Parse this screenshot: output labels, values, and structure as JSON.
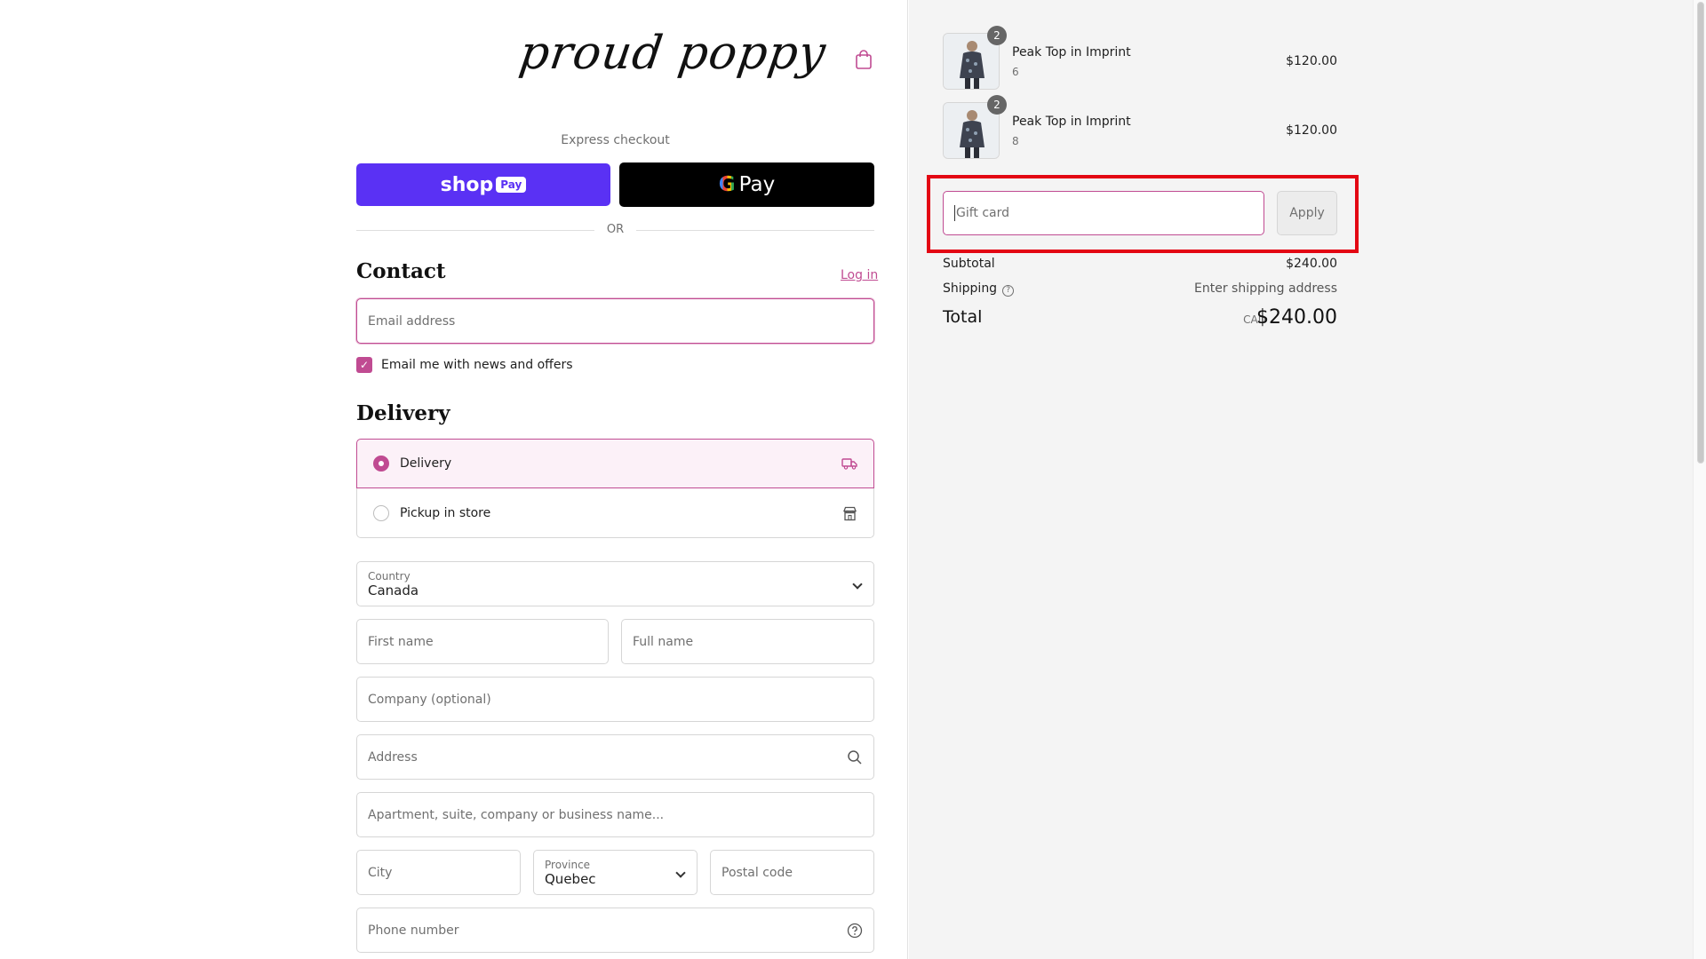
{
  "header": {
    "logo_text": "proud poppy"
  },
  "express": {
    "label": "Express checkout",
    "shop_pay": {
      "shop": "shop",
      "pay": "Pay"
    },
    "google_pay": {
      "g": "G",
      "pay": "Pay"
    },
    "or": "OR"
  },
  "contact": {
    "heading": "Contact",
    "login_link": "Log in",
    "email_placeholder": "Email address",
    "newsletter_label": "Email me with news and offers",
    "newsletter_checked": true
  },
  "delivery": {
    "heading": "Delivery",
    "options": [
      {
        "label": "Delivery",
        "selected": true,
        "icon": "truck-icon"
      },
      {
        "label": "Pickup in store",
        "selected": false,
        "icon": "store-icon"
      }
    ],
    "country": {
      "label": "Country",
      "value": "Canada"
    },
    "first_name_placeholder": "First name",
    "last_name_placeholder": "Full name",
    "company_placeholder": "Company (optional)",
    "address_placeholder": "Address",
    "apartment_placeholder": "Apartment, suite, company or business name...",
    "city_placeholder": "City",
    "province": {
      "label": "Province",
      "value": "Quebec"
    },
    "postal_placeholder": "Postal code",
    "phone_placeholder": "Phone number"
  },
  "order": {
    "items": [
      {
        "name": "Peak Top in Imprint",
        "variant": "6",
        "quantity": "2",
        "price": "$120.00"
      },
      {
        "name": "Peak Top in Imprint",
        "variant": "8",
        "quantity": "2",
        "price": "$120.00"
      }
    ],
    "gift_card_placeholder": "Gift card",
    "apply_label": "Apply",
    "subtotal_label": "Subtotal",
    "subtotal_value": "$240.00",
    "shipping_label": "Shipping",
    "shipping_value": "Enter shipping address",
    "total_label": "Total",
    "currency": "CAD",
    "total_value": "$240.00"
  },
  "colors": {
    "accent": "#c04b92",
    "shop_pay": "#5a31f4",
    "highlight": "#e30613"
  }
}
